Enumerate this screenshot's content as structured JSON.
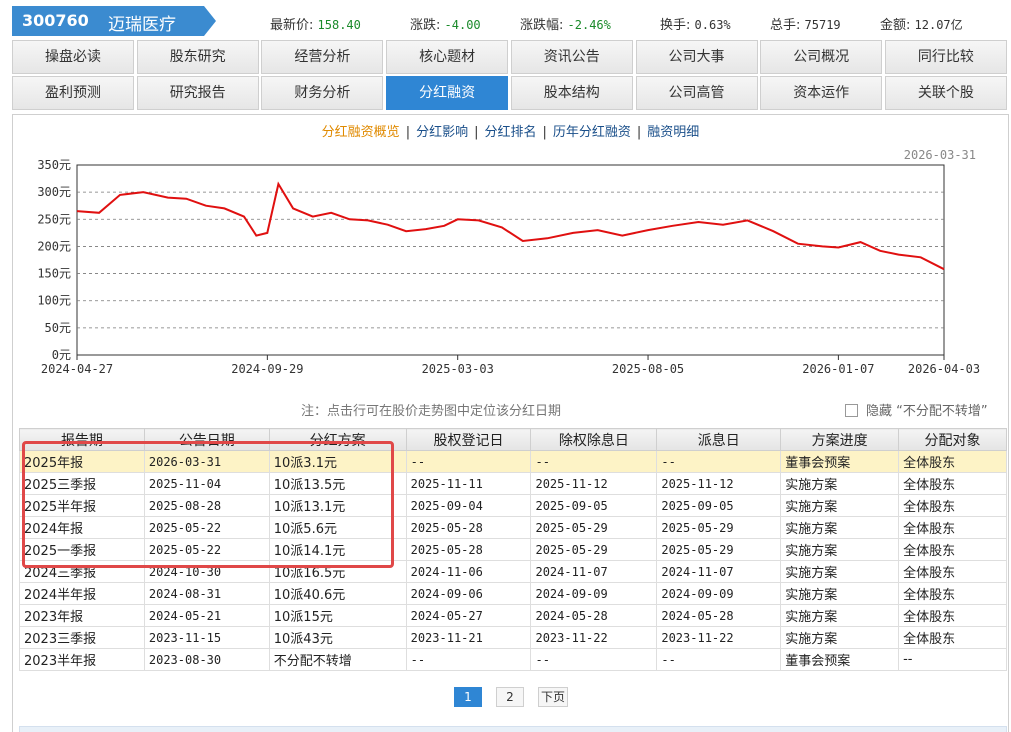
{
  "stock": {
    "code": "300760",
    "name": "迈瑞医疗"
  },
  "quote": {
    "price_label": "最新价:",
    "price": "158.40",
    "change_label": "涨跌:",
    "change": "-4.00",
    "pct_label": "涨跌幅:",
    "pct": "-2.46%",
    "turnover_label": "换手:",
    "turnover": "0.63%",
    "volume_label": "总手:",
    "volume": "75719",
    "amount_label": "金额:",
    "amount": "12.07亿"
  },
  "nav": {
    "row1": [
      "操盘必读",
      "股东研究",
      "经营分析",
      "核心题材",
      "资讯公告",
      "公司大事",
      "公司概况",
      "同行比较"
    ],
    "row2": [
      "盈利预测",
      "研究报告",
      "财务分析",
      "分红融资",
      "股本结构",
      "公司高管",
      "资本运作",
      "关联个股"
    ],
    "active": "分红融资"
  },
  "subnav": [
    "分红融资概览",
    "分红影响",
    "分红排名",
    "历年分红融资",
    "融资明细"
  ],
  "chart_data": {
    "type": "line",
    "date_label": "2026-03-31",
    "y_ticks": [
      "350元",
      "300元",
      "250元",
      "200元",
      "150元",
      "100元",
      "50元",
      "0元"
    ],
    "ylim": [
      0,
      350
    ],
    "x_ticks": [
      "2024-04-27",
      "2024-09-29",
      "2025-03-03",
      "2025-08-05",
      "2026-01-07",
      "2026-04-03"
    ],
    "series": [
      {
        "color": "#e01010",
        "x": [
          "2024-04-27",
          "2024-05-15",
          "2024-06-01",
          "2024-06-20",
          "2024-07-10",
          "2024-07-25",
          "2024-08-10",
          "2024-08-25",
          "2024-09-10",
          "2024-09-20",
          "2024-09-29",
          "2024-10-08",
          "2024-10-20",
          "2024-11-05",
          "2024-11-20",
          "2024-12-05",
          "2024-12-20",
          "2025-01-05",
          "2025-01-20",
          "2025-02-05",
          "2025-02-20",
          "2025-03-03",
          "2025-03-20",
          "2025-04-08",
          "2025-04-25",
          "2025-05-15",
          "2025-06-05",
          "2025-06-25",
          "2025-07-15",
          "2025-08-05",
          "2025-08-25",
          "2025-09-15",
          "2025-10-05",
          "2025-10-25",
          "2025-11-15",
          "2025-12-05",
          "2025-12-25",
          "2026-01-07",
          "2026-01-25",
          "2026-02-10",
          "2026-02-25",
          "2026-03-15",
          "2026-04-03"
        ],
        "values": [
          265,
          262,
          295,
          300,
          290,
          288,
          275,
          270,
          255,
          220,
          225,
          315,
          270,
          255,
          262,
          250,
          248,
          240,
          228,
          232,
          238,
          250,
          248,
          235,
          210,
          215,
          225,
          230,
          220,
          230,
          238,
          245,
          240,
          248,
          228,
          205,
          200,
          198,
          208,
          192,
          185,
          180,
          158
        ]
      }
    ]
  },
  "note": "注：点击行可在股价走势图中定位该分红日期",
  "hide_label": "隐藏 “不分配不转增”",
  "table": {
    "headers": [
      "报告期",
      "公告日期",
      "分红方案",
      "股权登记日",
      "除权除息日",
      "派息日",
      "方案进度",
      "分配对象"
    ],
    "rows": [
      [
        "2025年报",
        "2026-03-31",
        "10派3.1元",
        "--",
        "--",
        "--",
        "董事会预案",
        "全体股东"
      ],
      [
        "2025三季报",
        "2025-11-04",
        "10派13.5元",
        "2025-11-11",
        "2025-11-12",
        "2025-11-12",
        "实施方案",
        "全体股东"
      ],
      [
        "2025半年报",
        "2025-08-28",
        "10派13.1元",
        "2025-09-04",
        "2025-09-05",
        "2025-09-05",
        "实施方案",
        "全体股东"
      ],
      [
        "2024年报",
        "2025-05-22",
        "10派5.6元",
        "2025-05-28",
        "2025-05-29",
        "2025-05-29",
        "实施方案",
        "全体股东"
      ],
      [
        "2025一季报",
        "2025-05-22",
        "10派14.1元",
        "2025-05-28",
        "2025-05-29",
        "2025-05-29",
        "实施方案",
        "全体股东"
      ],
      [
        "2024三季报",
        "2024-10-30",
        "10派16.5元",
        "2024-11-06",
        "2024-11-07",
        "2024-11-07",
        "实施方案",
        "全体股东"
      ],
      [
        "2024半年报",
        "2024-08-31",
        "10派40.6元",
        "2024-09-06",
        "2024-09-09",
        "2024-09-09",
        "实施方案",
        "全体股东"
      ],
      [
        "2023年报",
        "2024-05-21",
        "10派15元",
        "2024-05-27",
        "2024-05-28",
        "2024-05-28",
        "实施方案",
        "全体股东"
      ],
      [
        "2023三季报",
        "2023-11-15",
        "10派43元",
        "2023-11-21",
        "2023-11-22",
        "2023-11-22",
        "实施方案",
        "全体股东"
      ],
      [
        "2023半年报",
        "2023-08-30",
        "不分配不转增",
        "--",
        "--",
        "--",
        "董事会预案",
        "--"
      ]
    ]
  },
  "pager": {
    "pages": [
      "1",
      "2"
    ],
    "current": "1",
    "next": "下页"
  }
}
